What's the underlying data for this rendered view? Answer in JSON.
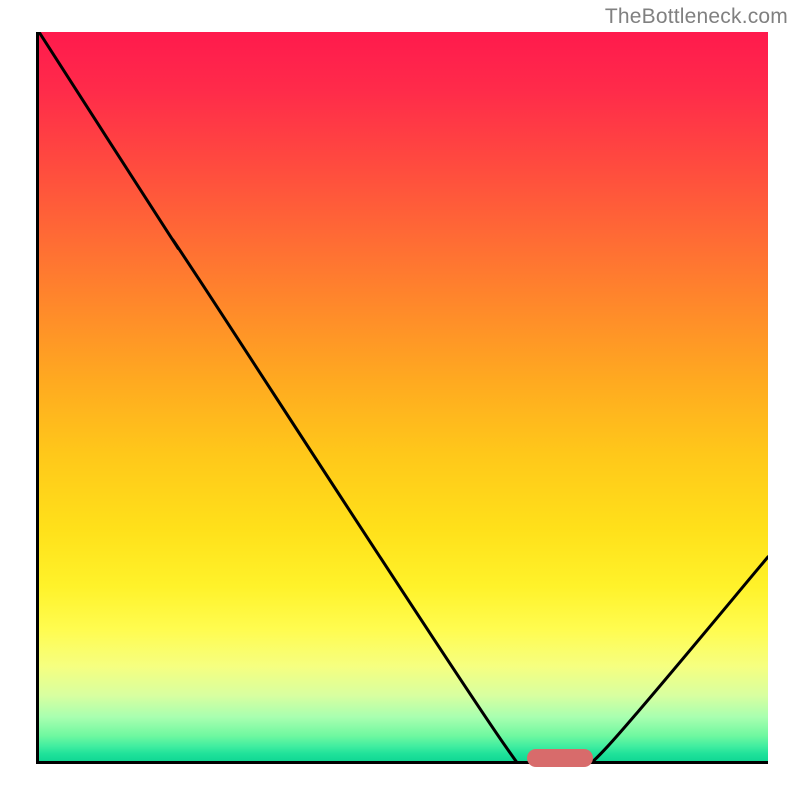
{
  "watermark": "TheBottleneck.com",
  "chart_data": {
    "type": "line",
    "title": "",
    "xlabel": "",
    "ylabel": "",
    "xlim": [
      0,
      100
    ],
    "ylim": [
      0,
      100
    ],
    "grid": false,
    "legend": false,
    "curve": [
      {
        "x": 0,
        "y": 100
      },
      {
        "x": 18,
        "y": 72
      },
      {
        "x": 22,
        "y": 66
      },
      {
        "x": 64,
        "y": 2
      },
      {
        "x": 68,
        "y": 0
      },
      {
        "x": 74,
        "y": 0
      },
      {
        "x": 78,
        "y": 2
      },
      {
        "x": 100,
        "y": 28
      }
    ],
    "optimum_marker": {
      "x_start": 67,
      "x_end": 76,
      "y": 0
    }
  },
  "colors": {
    "curve": "#000000",
    "marker": "#d86b6b",
    "axis": "#000000"
  }
}
